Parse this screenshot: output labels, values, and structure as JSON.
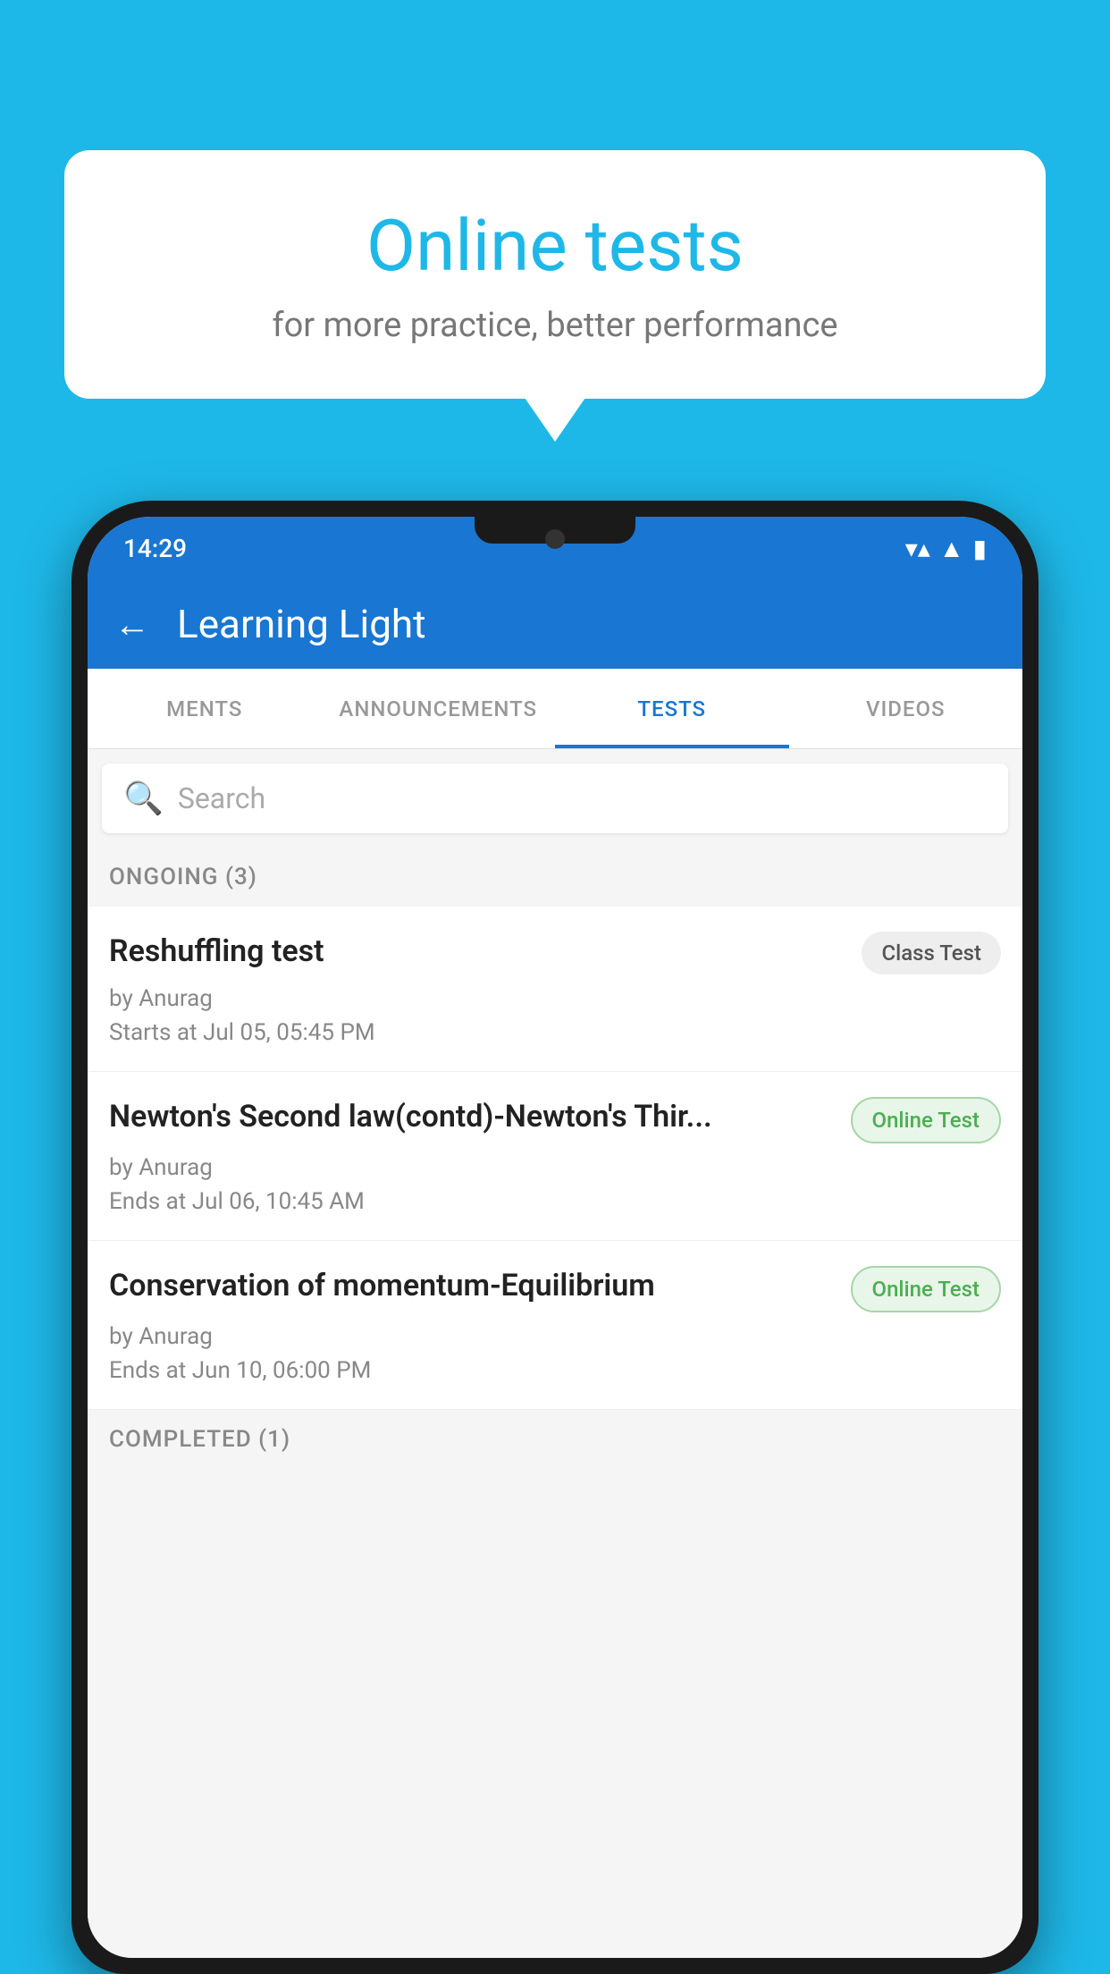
{
  "bubble": {
    "title": "Online tests",
    "subtitle": "for more practice, better performance"
  },
  "status_bar": {
    "time": "14:29",
    "wifi": "▼",
    "signal": "▲",
    "battery": "▮"
  },
  "app_bar": {
    "back_label": "←",
    "title": "Learning Light"
  },
  "tabs": [
    {
      "label": "MENTS",
      "active": false
    },
    {
      "label": "ANNOUNCEMENTS",
      "active": false
    },
    {
      "label": "TESTS",
      "active": true
    },
    {
      "label": "VIDEOS",
      "active": false
    }
  ],
  "search": {
    "placeholder": "Search"
  },
  "ongoing_section": {
    "label": "ONGOING (3)"
  },
  "tests": [
    {
      "title": "Reshuffling test",
      "badge": "Class Test",
      "badge_type": "class",
      "by": "by Anurag",
      "date": "Starts at  Jul 05, 05:45 PM"
    },
    {
      "title": "Newton's Second law(contd)-Newton's Thir...",
      "badge": "Online Test",
      "badge_type": "online",
      "by": "by Anurag",
      "date": "Ends at  Jul 06, 10:45 AM"
    },
    {
      "title": "Conservation of momentum-Equilibrium",
      "badge": "Online Test",
      "badge_type": "online",
      "by": "by Anurag",
      "date": "Ends at  Jun 10, 06:00 PM"
    }
  ],
  "completed_section": {
    "label": "COMPLETED (1)"
  }
}
